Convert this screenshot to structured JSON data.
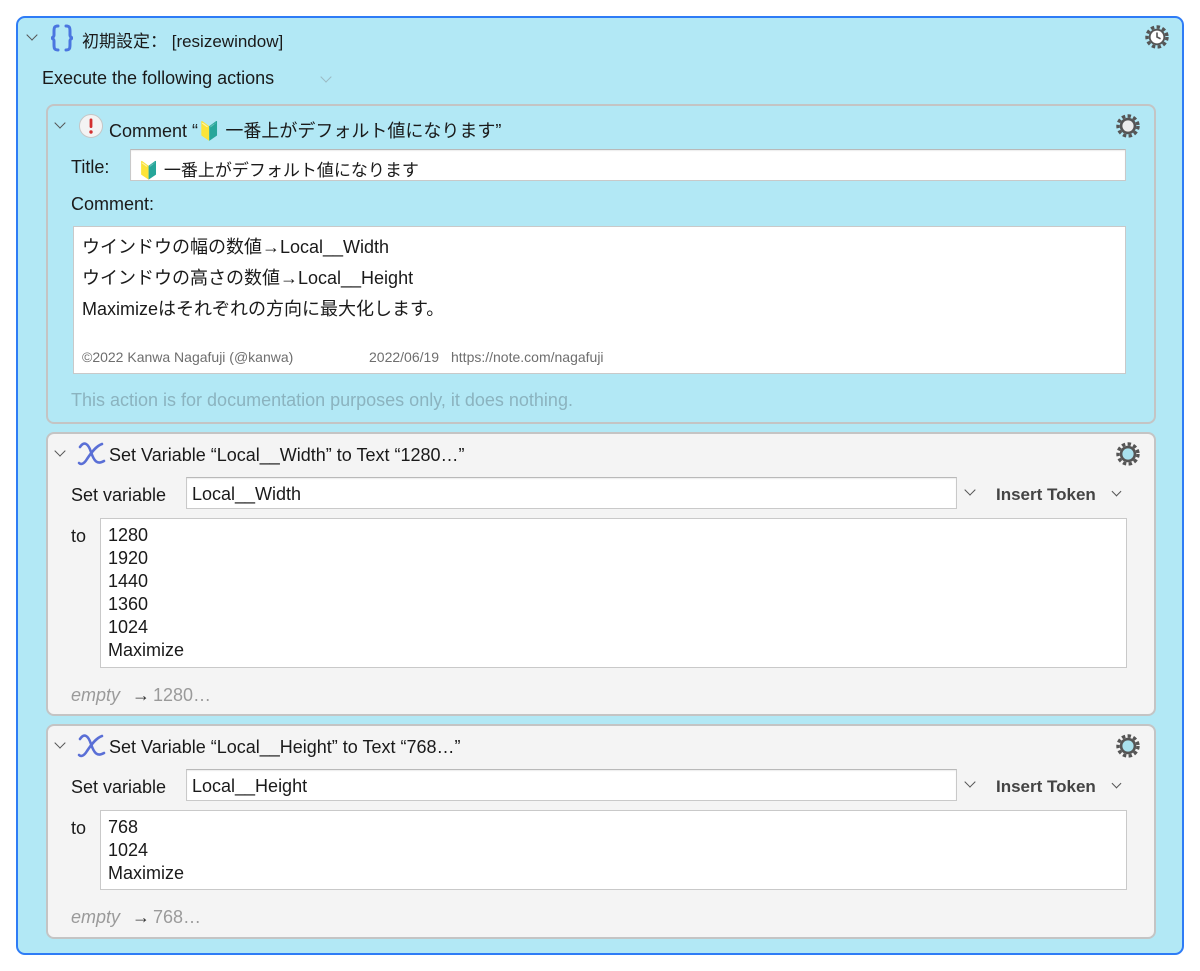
{
  "group": {
    "title": "初期設定： [resizewindow]",
    "execute_label": "Execute the following actions"
  },
  "comment_action": {
    "header": "Comment “🔰 一番上がデフォルト値になります”",
    "title_label": "Title:",
    "title_value": "🔰 一番上がデフォルト値になります",
    "comment_label": "Comment:",
    "comment_lines": [
      "ウインドウの幅の数値→Local__Width",
      "ウインドウの高さの数値→Local__Height",
      "Maximizeはそれぞれの方向に最大化します。"
    ],
    "footer_credit": "©2022 Kanwa Nagafuji (@kanwa)",
    "footer_date": "2022/06/19",
    "footer_url": "https://note.com/nagafuji",
    "doc_note": "This action is for documentation purposes only, it does nothing."
  },
  "setvar_width": {
    "header": "Set Variable “Local__Width” to Text “1280…”",
    "set_label": "Set variable",
    "var_name": "Local__Width",
    "insert_token": "Insert Token",
    "to_label": "to",
    "values": [
      "1280",
      "1920",
      "1440",
      "1360",
      "1024",
      "Maximize"
    ],
    "summary_empty": "empty",
    "summary_arrow": "→",
    "summary_value": "1280…"
  },
  "setvar_height": {
    "header": "Set Variable “Local__Height” to Text “768…”",
    "set_label": "Set variable",
    "var_name": "Local__Height",
    "insert_token": "Insert Token",
    "to_label": "to",
    "values": [
      "768",
      "1024",
      "Maximize"
    ],
    "summary_empty": "empty",
    "summary_arrow": "→",
    "summary_value": "768…"
  },
  "colors": {
    "group_bg": "#b2e8f5",
    "group_border": "#2e7cf6",
    "variable_icon": "#5a6fd6",
    "bracket_icon": "#4a76e0"
  },
  "icons": {
    "group": "curly-braces-icon",
    "comment": "exclamation-circle-icon",
    "setvar": "variable-x-icon",
    "gear": "gear-icon",
    "gear_clock": "gear-clock-icon"
  }
}
